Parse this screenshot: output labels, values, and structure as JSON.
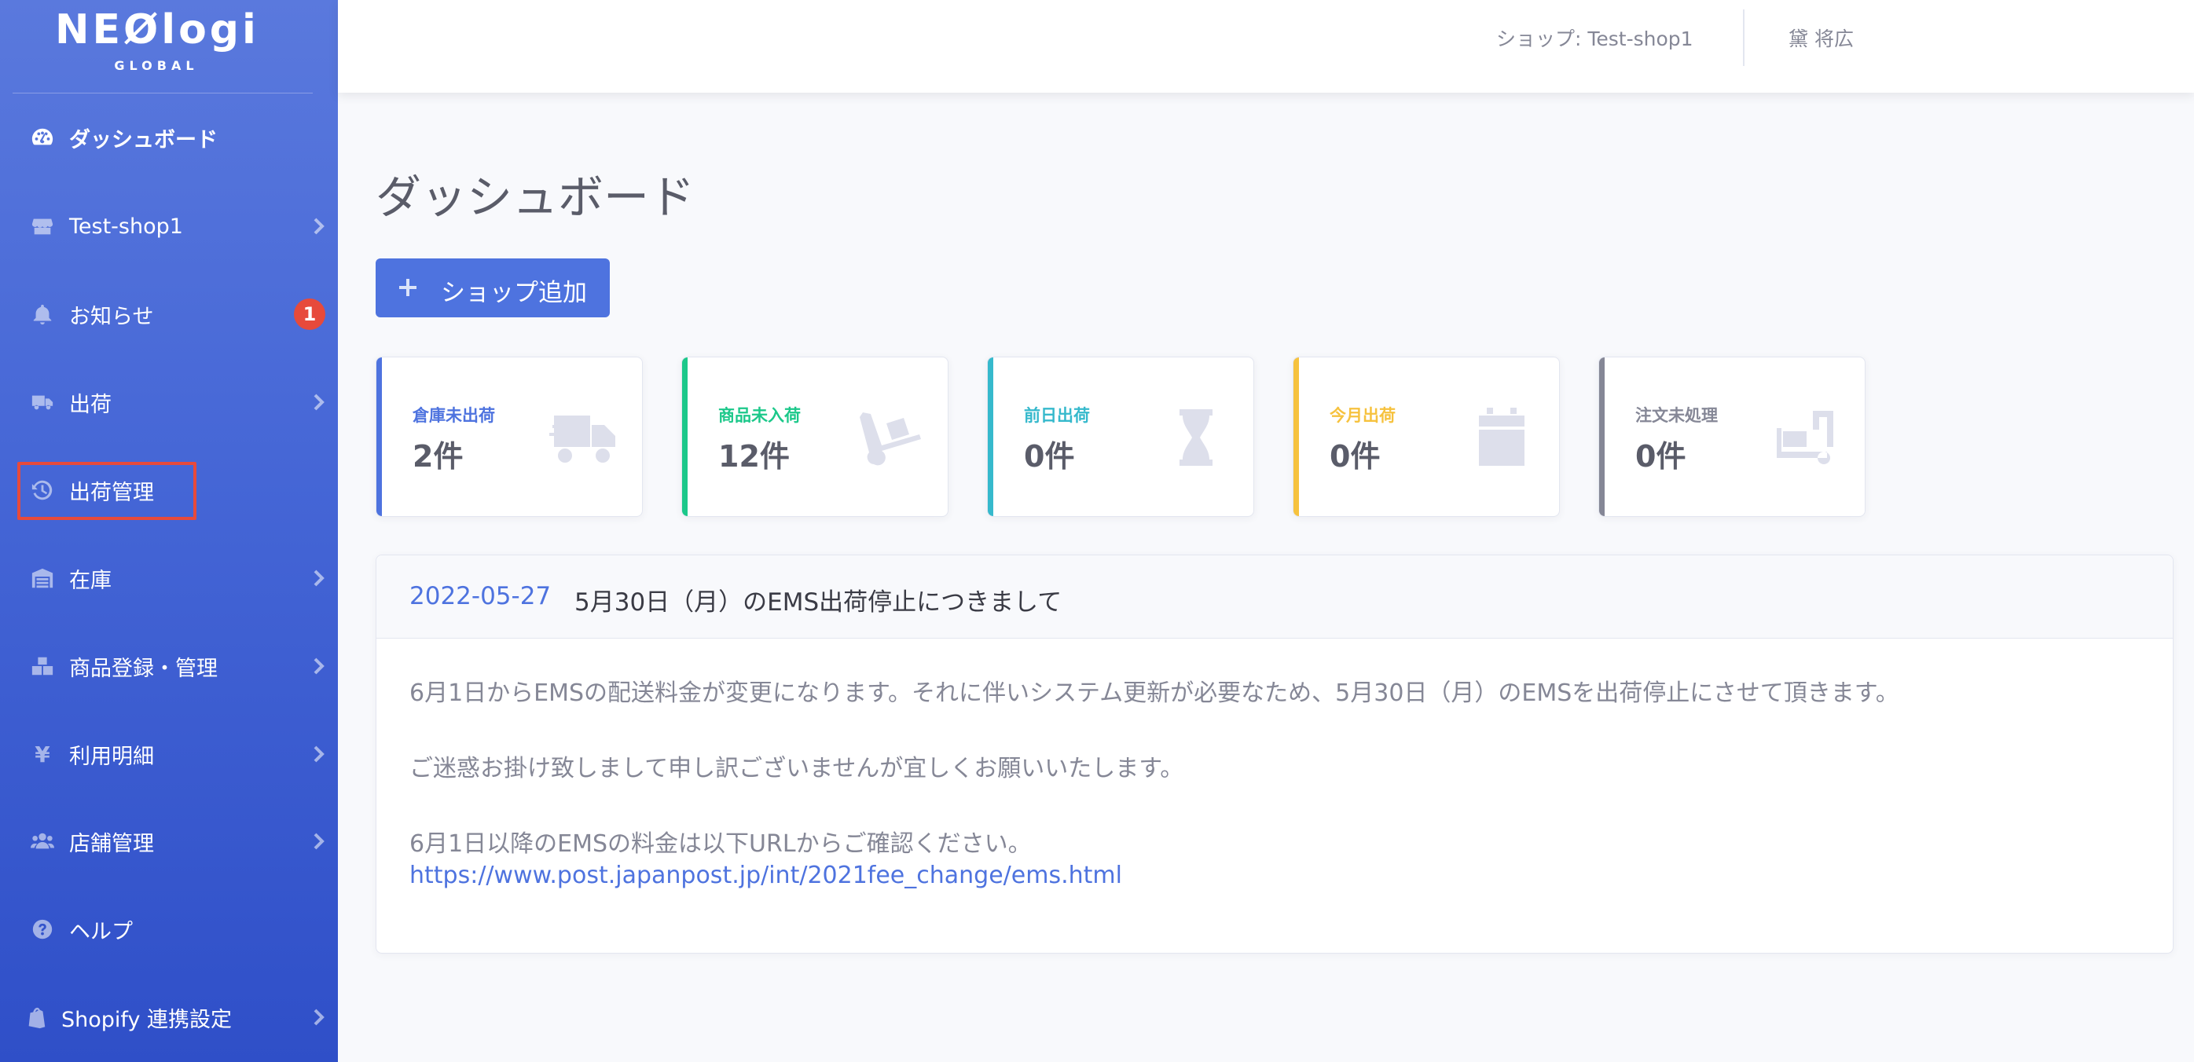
{
  "brand": {
    "name": "NEØlogi",
    "sub": "GLOBAL"
  },
  "sidebar": {
    "items": [
      {
        "label": "ダッシュボード",
        "icon": "tachometer-icon",
        "active": true
      },
      {
        "label": "Test-shop1",
        "icon": "store-icon",
        "chevron": true
      },
      {
        "label": "お知らせ",
        "icon": "bell-icon",
        "badge": "1"
      },
      {
        "label": "出荷",
        "icon": "truck-icon",
        "chevron": true
      },
      {
        "label": "出荷管理",
        "icon": "history-icon",
        "highlighted": true
      },
      {
        "label": "在庫",
        "icon": "warehouse-icon",
        "chevron": true
      },
      {
        "label": "商品登録・管理",
        "icon": "boxes-icon",
        "chevron": true
      },
      {
        "label": "利用明細",
        "icon": "yen-icon",
        "chevron": true
      },
      {
        "label": "店舗管理",
        "icon": "users-icon",
        "chevron": true
      },
      {
        "label": "ヘルプ",
        "icon": "question-circle-icon"
      },
      {
        "label": "Shopify 連携設定",
        "icon": "shopify-icon",
        "chevron": true
      }
    ]
  },
  "topbar": {
    "shop": "ショップ: Test-shop1",
    "user": "黛 将広"
  },
  "main": {
    "title": "ダッシュボード",
    "add_button": "ショップ追加",
    "cards": [
      {
        "title": "倉庫未出荷",
        "value": "2件",
        "color": "#4e73df",
        "icon": "truck-icon"
      },
      {
        "title": "商品未入荷",
        "value": "12件",
        "color": "#1cc88a",
        "icon": "dolly-icon"
      },
      {
        "title": "前日出荷",
        "value": "0件",
        "color": "#36b9cc",
        "icon": "hourglass-icon"
      },
      {
        "title": "今月出荷",
        "value": "0件",
        "color": "#f6c23e",
        "icon": "calendar-icon"
      },
      {
        "title": "注文未処理",
        "value": "0件",
        "color": "#858796",
        "icon": "dolly-flatbed-icon"
      }
    ],
    "notice": {
      "date": "2022-05-27",
      "title": "5月30日（月）のEMS出荷停止につきまして",
      "paragraph1": "6月1日からEMSの配送料金が変更になります。それに伴いシステム更新が必要なため、5月30日（月）のEMSを出荷停止にさせて頂きます。",
      "paragraph2": "ご迷惑お掛け致しまして申し訳ございませんが宜しくお願いいたします。",
      "paragraph3": "6月1日以降のEMSの料金は以下URLからご確認ください。",
      "link": "https://www.post.japanpost.jp/int/2021fee_change/ems.html"
    }
  }
}
